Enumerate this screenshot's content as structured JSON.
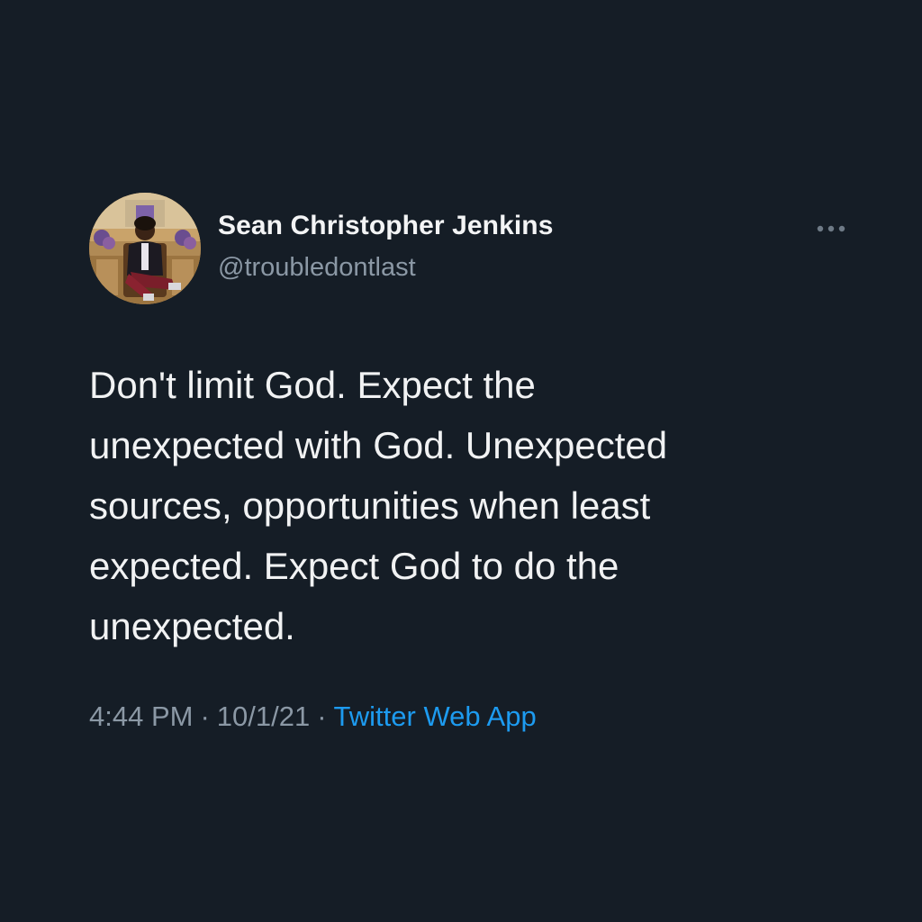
{
  "tweet": {
    "author": {
      "display_name": "Sean Christopher Jenkins",
      "handle": "@troubledontlast",
      "avatar_icon": "profile-photo"
    },
    "more_icon": "more-options-icon",
    "text": "Don't limit God. Expect the\nunexpected with God. Unexpected\nsources, opportunities when least\nexpected. Expect God to do the\nunexpected.",
    "time": "4:44 PM",
    "separator": "·",
    "date": "10/1/21",
    "source": "Twitter Web App"
  },
  "colors": {
    "background": "#151d26",
    "text_primary": "#f1f2f3",
    "text_secondary": "#8b98a5",
    "link": "#1d9bf0"
  }
}
